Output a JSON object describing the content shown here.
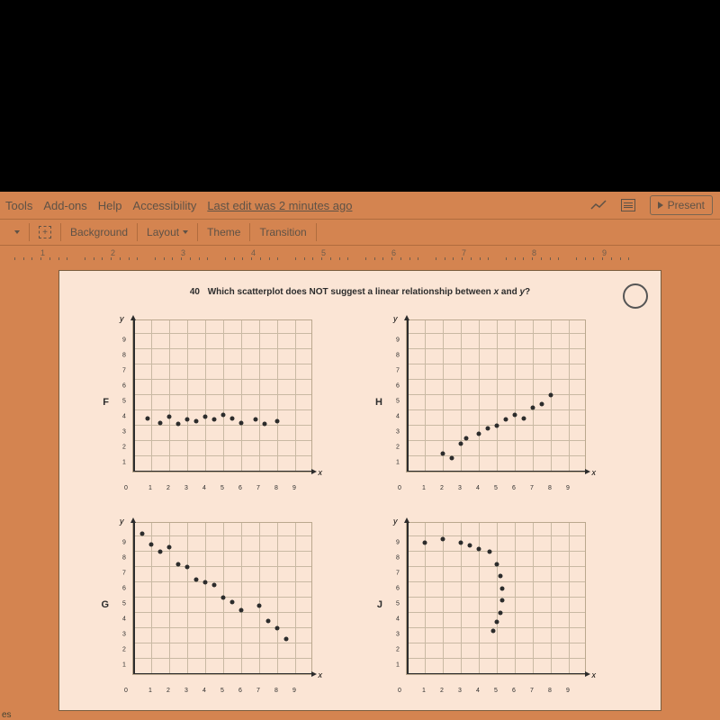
{
  "menubar": {
    "items": [
      "Tools",
      "Add-ons",
      "Help",
      "Accessibility"
    ],
    "edit_status": "Last edit was 2 minutes ago",
    "present_label": "Present"
  },
  "toolbar": {
    "items": [
      "Background",
      "Layout",
      "Theme",
      "Transition"
    ]
  },
  "ruler": {
    "marks": [
      "1",
      "2",
      "3",
      "4",
      "5",
      "6",
      "7",
      "8",
      "9"
    ]
  },
  "question": {
    "number": "40",
    "text_pre": "Which scatterplot does NOT suggest a linear relationship between ",
    "var1": "x",
    "between": " and ",
    "var2": "y",
    "text_post": "?"
  },
  "chart_common": {
    "xlabel": "x",
    "ylabel": "y",
    "origin": "0",
    "xticks": [
      "1",
      "2",
      "3",
      "4",
      "5",
      "6",
      "7",
      "8",
      "9"
    ],
    "yticks": [
      "1",
      "2",
      "3",
      "4",
      "5",
      "6",
      "7",
      "8",
      "9"
    ],
    "xrange": [
      0,
      10
    ],
    "yrange": [
      0,
      10
    ]
  },
  "chart_data": [
    {
      "label": "F",
      "type": "scatter",
      "x": [
        0.8,
        1.5,
        2,
        2.5,
        3,
        3.5,
        4,
        4.5,
        5,
        5.5,
        6,
        6.8,
        7.3,
        8
      ],
      "y": [
        3.5,
        3.2,
        3.6,
        3.1,
        3.4,
        3.3,
        3.6,
        3.4,
        3.7,
        3.5,
        3.2,
        3.4,
        3.1,
        3.3
      ]
    },
    {
      "label": "H",
      "type": "scatter",
      "x": [
        2,
        2.5,
        3,
        3.3,
        4,
        4.5,
        5,
        5.5,
        6,
        6.5,
        7,
        7.5,
        8
      ],
      "y": [
        1.2,
        0.9,
        1.8,
        2.2,
        2.5,
        2.8,
        3.0,
        3.4,
        3.7,
        3.5,
        4.2,
        4.4,
        5.0
      ]
    },
    {
      "label": "G",
      "type": "scatter",
      "x": [
        0.5,
        1,
        1.5,
        2,
        2.5,
        3,
        3.5,
        4,
        4.5,
        5,
        5.5,
        6,
        7,
        7.5,
        8,
        8.5
      ],
      "y": [
        9.2,
        8.5,
        8.0,
        8.3,
        7.2,
        7.0,
        6.2,
        6.0,
        5.8,
        5.0,
        4.7,
        4.2,
        4.5,
        3.5,
        3.0,
        2.3
      ]
    },
    {
      "label": "J",
      "type": "scatter",
      "x": [
        1,
        2,
        3,
        3.5,
        4,
        4.6,
        5.0,
        5.2,
        5.3,
        5.3,
        5.2,
        5.0,
        4.8
      ],
      "y": [
        8.6,
        8.8,
        8.6,
        8.4,
        8.2,
        8.0,
        7.2,
        6.4,
        5.6,
        4.8,
        4.0,
        3.4,
        2.8
      ]
    }
  ],
  "footer_hint": "es"
}
